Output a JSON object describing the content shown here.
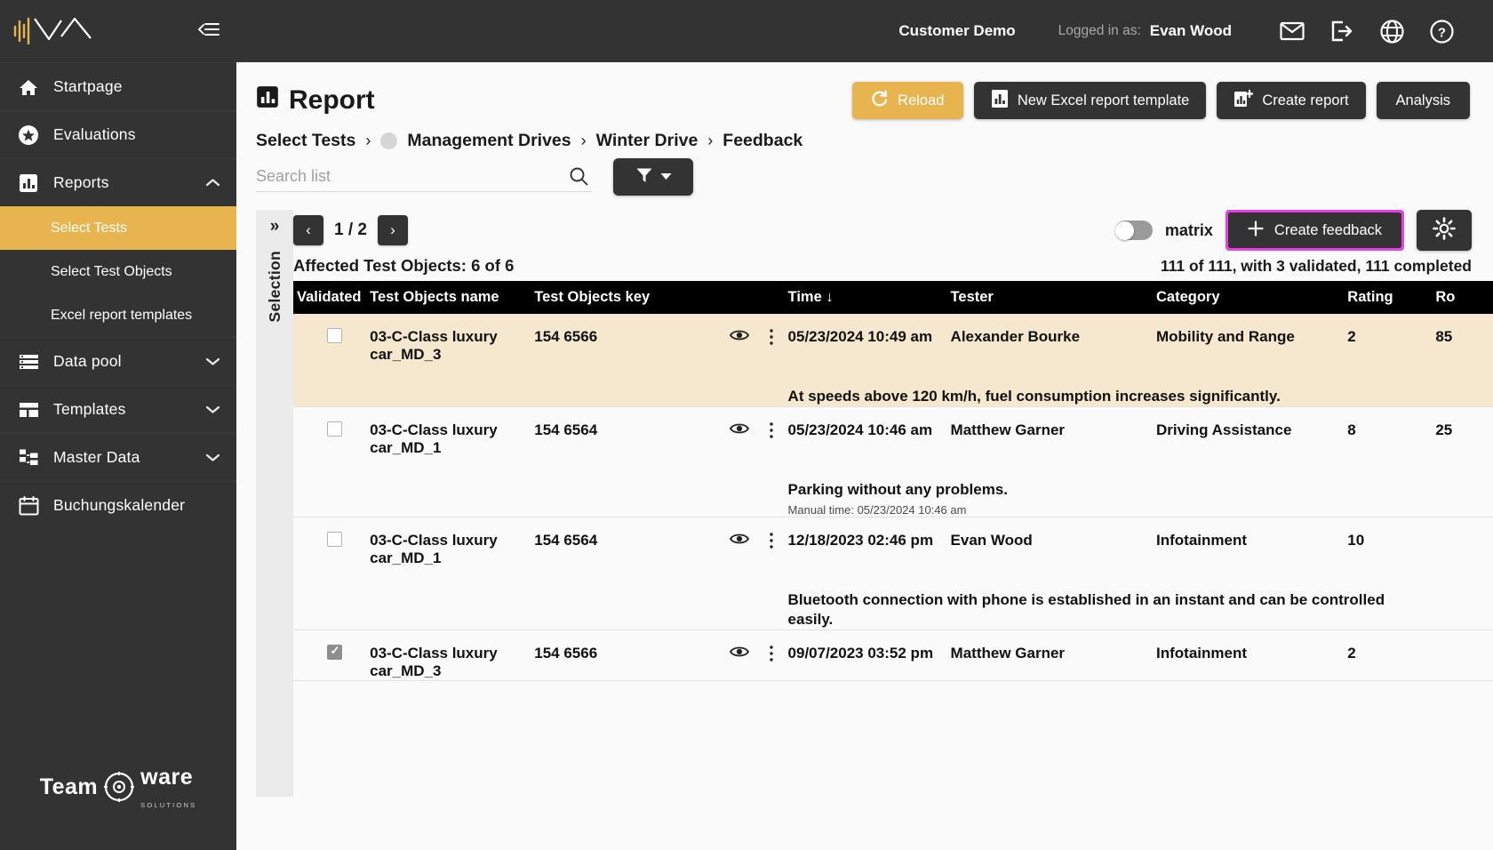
{
  "sidebar": {
    "logo_alt": "waveform-logo",
    "collapse_icon": "collapse-sidebar-icon",
    "items": [
      {
        "label": "Startpage",
        "icon": "home-icon",
        "expandable": false
      },
      {
        "label": "Evaluations",
        "icon": "star-icon",
        "expandable": false
      },
      {
        "label": "Reports",
        "icon": "bar-chart-icon",
        "expandable": true,
        "expanded": true
      },
      {
        "label": "Data pool",
        "icon": "list-icon",
        "expandable": true,
        "expanded": false
      },
      {
        "label": "Templates",
        "icon": "layout-icon",
        "expandable": true,
        "expanded": false
      },
      {
        "label": "Master Data",
        "icon": "hierarchy-icon",
        "expandable": true,
        "expanded": false
      },
      {
        "label": "Buchungskalender",
        "icon": "calendar-icon",
        "expandable": false
      }
    ],
    "sub_items": [
      {
        "label": "Select Tests",
        "active": true
      },
      {
        "label": "Select Test Objects",
        "active": false
      },
      {
        "label": "Excel report templates",
        "active": false
      }
    ],
    "footer_brand": "Team",
    "footer_brand2": "ware",
    "footer_sub": "SOLUTIONS"
  },
  "topbar": {
    "customer": "Customer Demo",
    "logged_in_label": "Logged in as:",
    "user": "Evan Wood",
    "icons": [
      "mail-icon",
      "logout-icon",
      "globe-icon",
      "help-icon"
    ]
  },
  "page": {
    "title": "Report",
    "title_icon": "bar-chart-icon"
  },
  "toolbar": {
    "reload": "Reload",
    "new_excel_template": "New Excel report template",
    "create_report": "Create report",
    "analysis": "Analysis",
    "reload_color": "#e8b44f",
    "button_color": "#333333"
  },
  "breadcrumb": {
    "items": [
      "Select Tests",
      "Management Drives",
      "Winter Drive",
      "Feedback"
    ],
    "separator": "›"
  },
  "search": {
    "placeholder": "Search list",
    "value": "",
    "icon": "search-icon"
  },
  "filter": {
    "icon": "filter-icon",
    "caret": "▾"
  },
  "selection_rail": {
    "expand_icon": "»",
    "label": "Selection"
  },
  "pagination": {
    "prev": "‹",
    "next": "›",
    "indicator": "1 / 2"
  },
  "matrix_toggle": {
    "label": "matrix",
    "on": false
  },
  "create_feedback": {
    "label": "Create feedback",
    "plus": "+",
    "highlight_color": "#e83ee8"
  },
  "settings_button": {
    "icon": "gear-icon"
  },
  "meta": {
    "affected": "Affected Test Objects: 6 of 6",
    "summary": "111 of 111, with 3 validated, 111 completed"
  },
  "table": {
    "columns": [
      "Validated",
      "Test Objects name",
      "Test Objects key",
      "",
      "Time ↓",
      "Tester",
      "Category",
      "Rating",
      "Ro"
    ],
    "sort_column": "Time",
    "sort_direction": "desc",
    "rows": [
      {
        "validated": false,
        "name": "03-C-Class luxury car_MD_3",
        "key": "154 6566",
        "time": "05/23/2024 10:49 am",
        "tester": "Alexander Bourke",
        "category": "Mobility and Range",
        "rating": "2",
        "ro": "85",
        "comment": "At speeds above 120 km/h, fuel consumption increases significantly.",
        "manual_time": "",
        "highlighted": true
      },
      {
        "validated": false,
        "name": "03-C-Class luxury car_MD_1",
        "key": "154 6564",
        "time": "05/23/2024 10:46 am",
        "tester": "Matthew Garner",
        "category": "Driving Assistance",
        "rating": "8",
        "ro": "25",
        "comment": "Parking without any problems.",
        "manual_time": "Manual time: 05/23/2024 10:46 am",
        "highlighted": false
      },
      {
        "validated": false,
        "name": "03-C-Class luxury car_MD_1",
        "key": "154 6564",
        "time": "12/18/2023 02:46 pm",
        "tester": "Evan Wood",
        "category": "Infotainment",
        "rating": "10",
        "ro": "",
        "comment": "Bluetooth connection with phone is established in an instant and can be controlled easily.",
        "manual_time": "",
        "highlighted": false
      },
      {
        "validated": true,
        "name": "03-C-Class luxury car_MD_3",
        "key": "154 6566",
        "time": "09/07/2023 03:52 pm",
        "tester": "Matthew Garner",
        "category": "Infotainment",
        "rating": "2",
        "ro": "",
        "comment": "",
        "manual_time": "",
        "highlighted": false
      }
    ],
    "row_icons": {
      "view": "eye-icon",
      "menu": "kebab-menu-icon"
    }
  }
}
